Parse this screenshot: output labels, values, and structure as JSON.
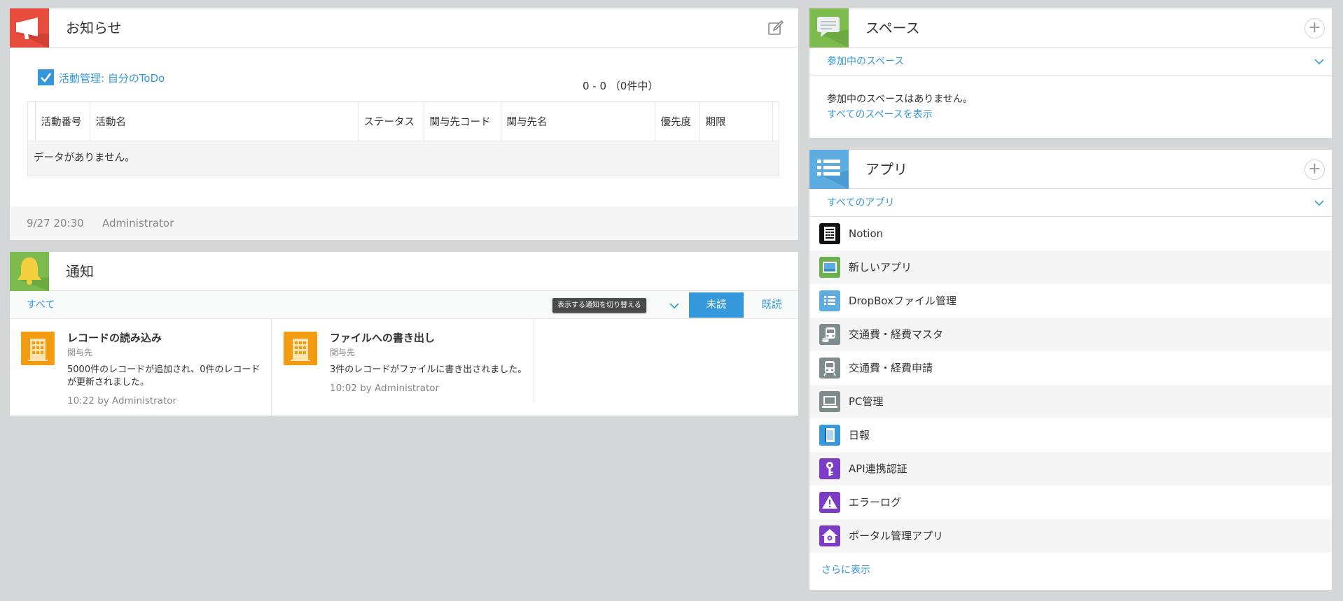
{
  "announcements": {
    "title": "お知らせ",
    "todo_label": "活動管理: 自分のToDo",
    "pager": "0 - 0 （0件中）",
    "columns": [
      "活動番号",
      "活動名",
      "ステータス",
      "関与先コード",
      "関与先名",
      "優先度",
      "期限"
    ],
    "empty_text": "データがありません。",
    "footer_time": "9/27 20:30",
    "footer_user": "Administrator"
  },
  "notifications": {
    "title": "通知",
    "filter_label": "すべて",
    "tooltip": "表示する通知を切り替える",
    "unread_button": "未読",
    "read_button": "既読",
    "items": [
      {
        "title": "レコードの読み込み",
        "sub": "関与先",
        "body_line1": "5000件のレコードが追加され、0件のレコード",
        "body_line2": "が更新されました。",
        "time": "10:22  by Administrator"
      },
      {
        "title": "ファイルへの書き出し",
        "sub": "関与先",
        "body_line1": "3件のレコードがファイルに書き出されました。",
        "body_line2": "",
        "time": "10:02  by Administrator"
      }
    ]
  },
  "spaces": {
    "title": "スペース",
    "filter_label": "参加中のスペース",
    "empty_text": "参加中のスペースはありません。",
    "show_all": "すべてのスペースを表示"
  },
  "apps": {
    "title": "アプリ",
    "filter_label": "すべてのアプリ",
    "items": [
      {
        "name": "Notion",
        "icon": "notion-icon",
        "color": "#111111"
      },
      {
        "name": "新しいアプリ",
        "icon": "new-app-icon",
        "color": "#6ab04c"
      },
      {
        "name": "DropBoxファイル管理",
        "icon": "list-icon",
        "color": "#5dade2"
      },
      {
        "name": "交通費・経費マスタ",
        "icon": "train-coins-icon",
        "color": "#7f8c8d"
      },
      {
        "name": "交通費・経費申請",
        "icon": "train-icon",
        "color": "#7f8c8d"
      },
      {
        "name": "PC管理",
        "icon": "computer-icon",
        "color": "#7f8c8d"
      },
      {
        "name": "日報",
        "icon": "notebook-icon",
        "color": "#3498db"
      },
      {
        "name": "API連携認証",
        "icon": "key-icon",
        "color": "#7d3cc8"
      },
      {
        "name": "エラーログ",
        "icon": "warning-icon",
        "color": "#7d3cc8"
      },
      {
        "name": "ポータル管理アプリ",
        "icon": "house-gear-icon",
        "color": "#7d3cc8"
      }
    ],
    "more": "さらに表示"
  },
  "colors": {
    "accent": "#3498db",
    "announce": "#e74c3c",
    "notify": "#7dbb4f",
    "spaces": "#7dbb4f",
    "apps": "#5dade2"
  }
}
